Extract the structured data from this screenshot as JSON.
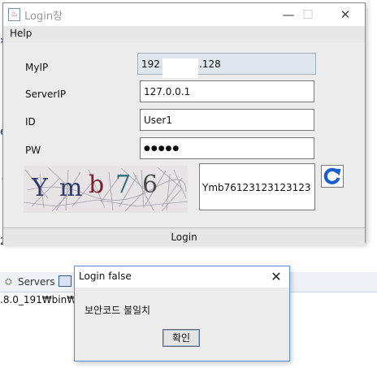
{
  "background": {
    "tab_servers": "Servers",
    "path_text": ".8.0_191₩bin₩ja"
  },
  "login_window": {
    "title": "Login창",
    "menu": {
      "help": "Help"
    },
    "fields": {
      "myip_label": "MyIP",
      "myip_value_start": "192",
      "myip_value_end": ".128",
      "serverip_label": "ServerIP",
      "serverip_value": "127.0.0.1",
      "id_label": "ID",
      "id_value": "User1",
      "pw_label": "PW",
      "pw_value": "●●●●●"
    },
    "captcha": {
      "chars": [
        "Y",
        "m",
        "b",
        "7",
        "6"
      ],
      "input_value": "Ymb76123123123123"
    },
    "login_button": "Login"
  },
  "dialog": {
    "title": "Login false",
    "message": "보안코드 불일치",
    "ok_button": "확인"
  },
  "colors": {
    "window_bg": "#ececec",
    "readonly_field": "#dfe7ec",
    "accent_blue": "#1a5fd0",
    "captcha_dark_blue": "#2b3a6b",
    "captcha_red": "#7a2030",
    "captcha_teal": "#2f6f7a"
  }
}
